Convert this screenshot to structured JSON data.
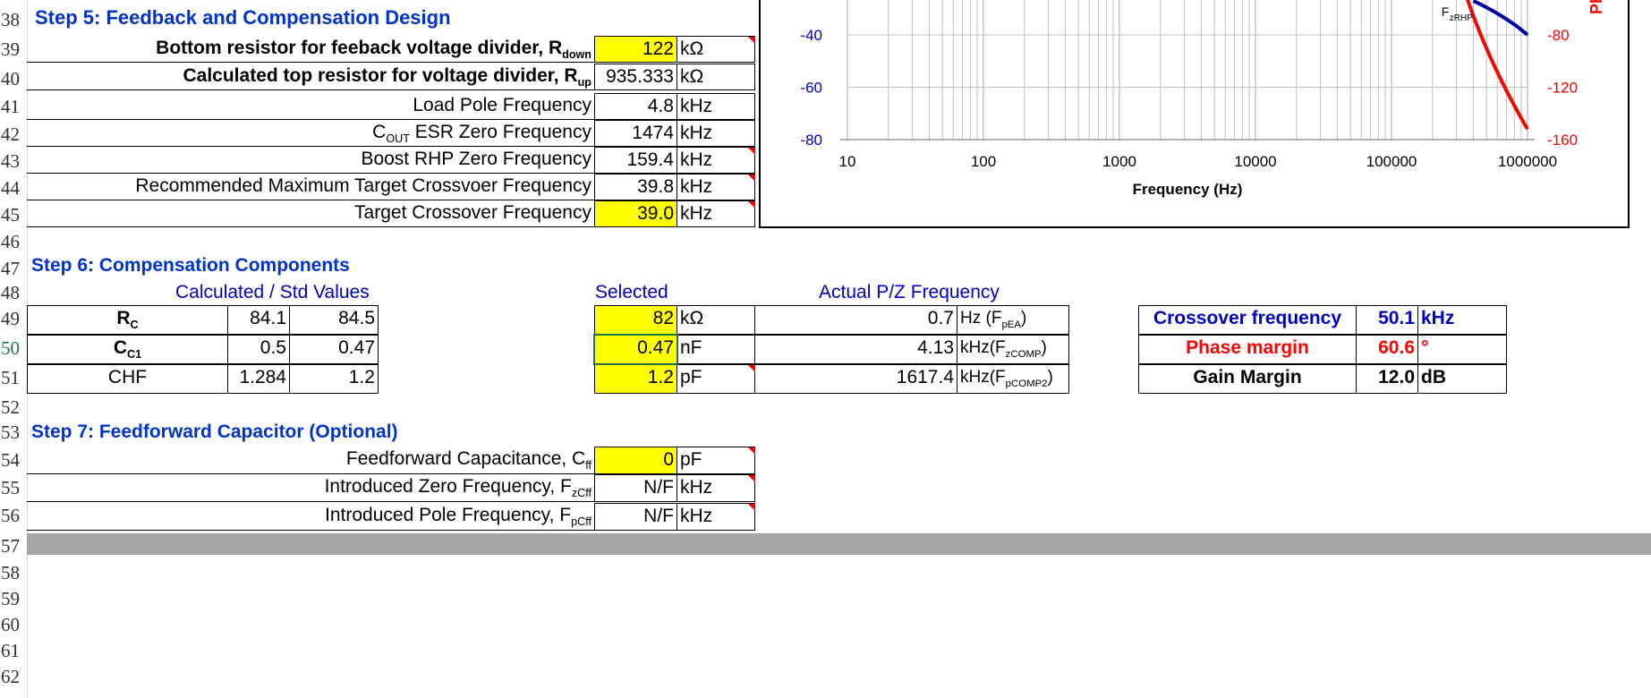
{
  "rows": [
    "38",
    "39",
    "40",
    "41",
    "42",
    "43",
    "44",
    "45",
    "46",
    "47",
    "48",
    "49",
    "50",
    "51",
    "52",
    "53",
    "54",
    "55",
    "56",
    "57",
    "58",
    "59",
    "60",
    "61",
    "62"
  ],
  "step5": {
    "title": "Step 5: Feedback and Compensation Design",
    "items": [
      {
        "label_main": "Bottom resistor for feeback voltage divider, R",
        "label_sub": "down",
        "value": "122",
        "unit": "kΩ"
      },
      {
        "label_main": "Calculated top resistor for voltage divider,  R",
        "label_sub": "up",
        "value": "935.333",
        "unit": "kΩ"
      },
      {
        "label_main": "Load Pole Frequency",
        "value": "4.8",
        "unit": "kHz"
      },
      {
        "label_pre": "C",
        "label_sub": "OUT",
        "label_main": " ESR Zero Frequency",
        "value": "1474",
        "unit": "kHz"
      },
      {
        "label_main": "Boost RHP Zero Frequency",
        "value": "159.4",
        "unit": "kHz"
      },
      {
        "label_main": "Recommended Maximum Target Crossvoer Frequency",
        "value": "39.8",
        "unit": "kHz"
      },
      {
        "label_main": "Target Crossover Frequency",
        "value": "39.0",
        "unit": "kHz"
      }
    ]
  },
  "step6": {
    "title": "Step 6: Compensation Components",
    "calc_header": "Calculated / Std Values",
    "selected_header": "Selected",
    "actual_header": "Actual P/Z Frequency",
    "rows": [
      {
        "name": "R",
        "name_sub": "C",
        "calc": "84.1",
        "std": "84.5",
        "selected": "82",
        "sel_unit": "kΩ",
        "actual": "0.7",
        "act_unit": "Hz (F",
        "act_sub": "pEA",
        "act_end": ")"
      },
      {
        "name": "C",
        "name_sub": "C1",
        "calc": "0.5",
        "std": "0.47",
        "selected": "0.47",
        "sel_unit": "nF",
        "actual": "4.13",
        "act_unit": "kHz(F",
        "act_sub": "zCOMP",
        "act_end": ")"
      },
      {
        "name": "CHF",
        "calc": "1.284",
        "std": "1.2",
        "selected": "1.2",
        "sel_unit": "pF",
        "actual": "1617.4",
        "act_unit": "kHz(F",
        "act_sub": "pCOMP2",
        "act_end": ")"
      }
    ],
    "summary": [
      {
        "label": "Crossover frequency",
        "value": "50.1",
        "unit": "kHz"
      },
      {
        "label": "Phase margin",
        "value": "60.6",
        "unit": "°"
      },
      {
        "label": "Gain Margin",
        "value": "12.0",
        "unit": "dB"
      }
    ]
  },
  "step7": {
    "title": "Step 7: Feedforward Capacitor (Optional)",
    "items": [
      {
        "label_main": "Feedforward Capacitance, C",
        "label_sub": "ff",
        "value": "0",
        "unit": "pF"
      },
      {
        "label_main": "Introduced Zero Frequency, F",
        "label_sub": "zCff",
        "value": "N/F",
        "unit": "kHz"
      },
      {
        "label_main": "Introduced Pole Frequency, F",
        "label_sub": "pCff",
        "value": "N/F",
        "unit": "kHz"
      }
    ]
  },
  "chart": {
    "xlabel": "Frequency (Hz)",
    "x_ticks": [
      "10",
      "100",
      "1000",
      "10000",
      "100000",
      "1000000"
    ],
    "y_left_ticks": [
      "-40",
      "-60",
      "-80"
    ],
    "y_right_ticks": [
      "-80",
      "-120",
      "-160"
    ],
    "right_axis_label_fragment": "Ph",
    "annotation_main": "F",
    "annotation_sub": "zRHP",
    "colors": {
      "gain": "#0000a0",
      "phase": "#ff0000",
      "grid": "#bfbfbf"
    }
  },
  "chart_data": {
    "type": "line",
    "title": "",
    "xlabel": "Frequency (Hz)",
    "xscale": "log",
    "xlim": [
      10,
      1000000
    ],
    "ylim_left_visible": [
      -80,
      -40
    ],
    "ylim_right_visible": [
      -160,
      -80
    ],
    "grid": true,
    "series": [
      {
        "axis": "left",
        "x": [
          400000,
          1000000
        ],
        "y": [
          -27,
          -40
        ]
      },
      {
        "axis": "right",
        "x": [
          320000,
          500000,
          1000000
        ],
        "y": [
          -40,
          -90,
          -152
        ]
      }
    ]
  }
}
